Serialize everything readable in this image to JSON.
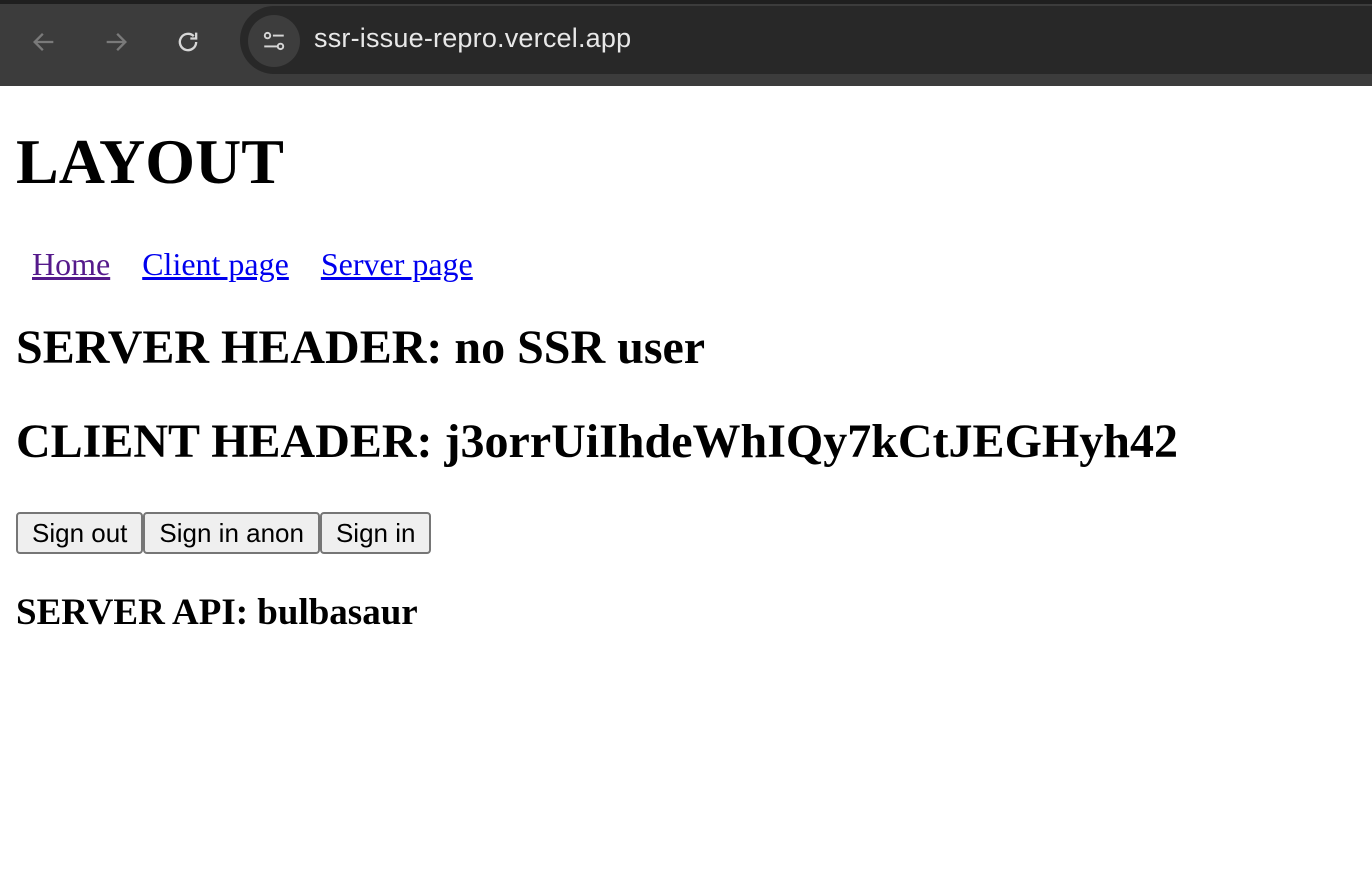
{
  "browser": {
    "url": "ssr-issue-repro.vercel.app",
    "icons": [
      "back-arrow-icon",
      "forward-arrow-icon",
      "reload-icon",
      "site-settings-icon"
    ]
  },
  "page": {
    "title": "LAYOUT",
    "nav": {
      "home": "Home",
      "client_page": "Client page",
      "server_page": "Server page"
    },
    "server_header": "SERVER HEADER: no SSR user",
    "client_header": "CLIENT HEADER: j3orrUiIhdeWhIQy7kCtJEGHyh42",
    "buttons": {
      "sign_out": "Sign out",
      "sign_in_anon": "Sign in anon",
      "sign_in": "Sign in"
    },
    "server_api": "SERVER API: bulbasaur"
  },
  "colors": {
    "link": "#0000ee",
    "visited_link": "#551a8b",
    "browser_bar": "#3c3c3c",
    "omnibox": "#282828"
  }
}
